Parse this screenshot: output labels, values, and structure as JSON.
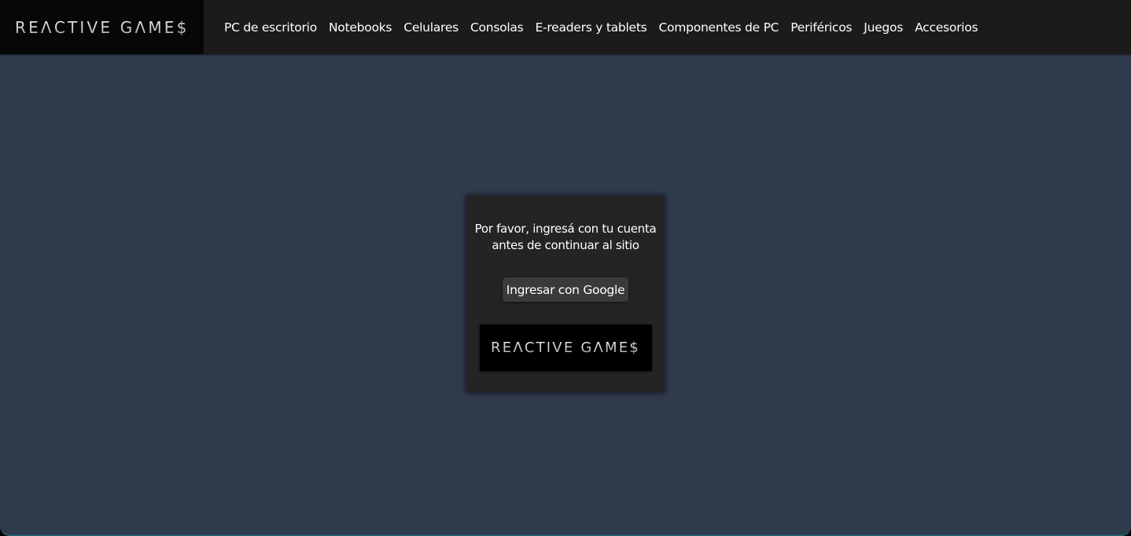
{
  "header": {
    "brand": "REΛCTIVE GΛME$",
    "nav": [
      "PC de escritorio",
      "Notebooks",
      "Celulares",
      "Consolas",
      "E-readers y tablets",
      "Componentes de PC",
      "Periféricos",
      "Juegos",
      "Accesorios"
    ]
  },
  "login": {
    "message_line1": "Por favor, ingresá con tu cuenta",
    "message_line2": "antes de continuar al sitio",
    "google_button": "Ingresar con Google",
    "logo": "REΛCTIVE GΛME$"
  },
  "colors": {
    "background": "#303a4d",
    "header": "#1b1b1b",
    "brand_bg": "#070707",
    "card": "#242425",
    "button": "#3a3a3d"
  }
}
